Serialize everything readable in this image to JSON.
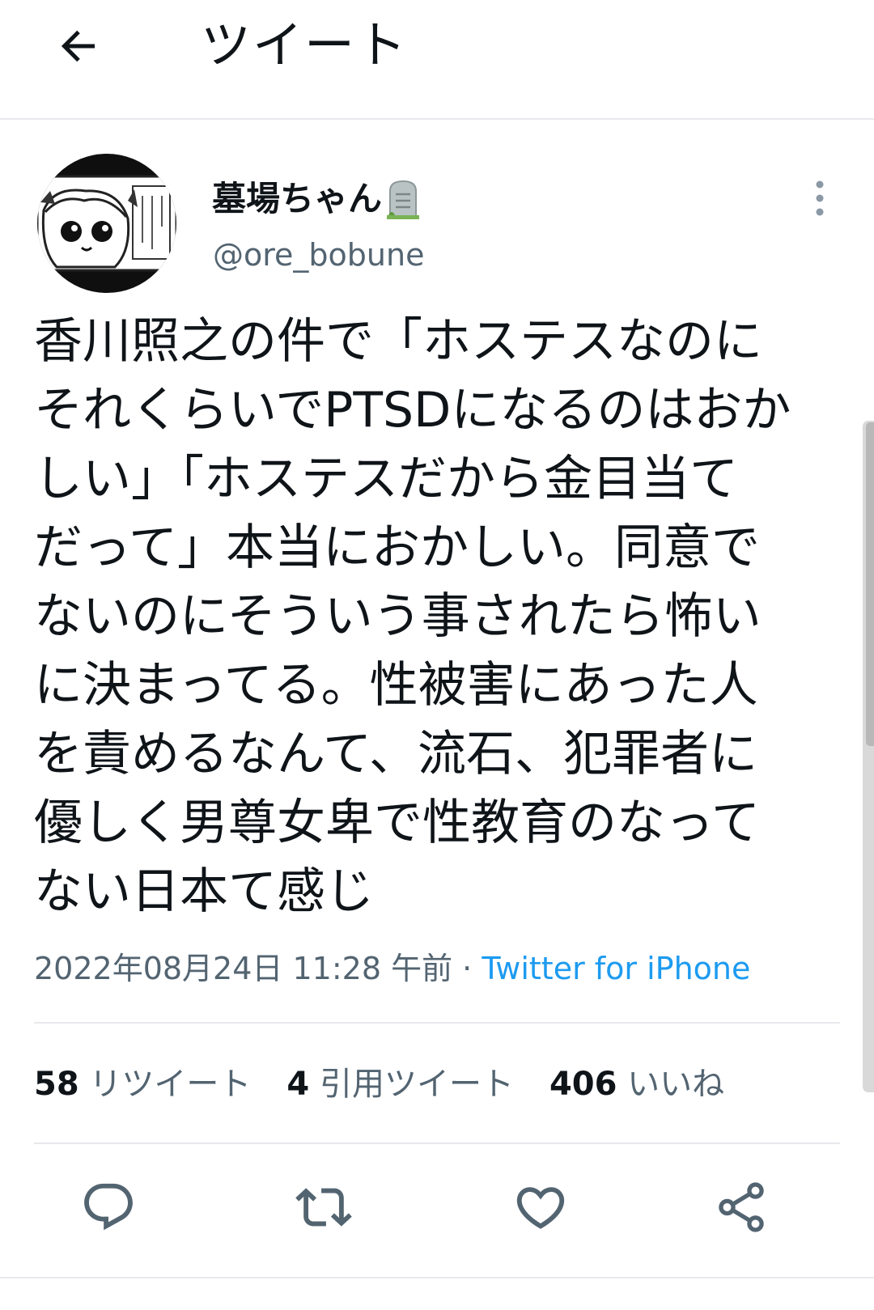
{
  "header": {
    "title": "ツイート",
    "back_icon": "arrow-left-icon"
  },
  "author": {
    "name": "墓場ちゃん",
    "handle": "@ore_bobune",
    "name_emoji": "headstone-icon"
  },
  "tweet": {
    "text": "香川照之の件で「ホステスなのに\nそれくらいでPTSDになるのはおか\nしい」「ホステスだから金目当て\nだって」本当におかしい。同意で\nないのにそういう事されたら怖い\nに決まってる。性被害にあった人\nを責めるなんて、流石、犯罪者に\n優しく男尊女卑で性教育のなって\nない日本て感じ",
    "timestamp": "2022年08月24日 11:28 午前",
    "separator": " · ",
    "client": "Twitter for iPhone"
  },
  "stats": {
    "retweets_count": "58",
    "retweets_label": "リツイート",
    "quotes_count": "4",
    "quotes_label": "引用ツイート",
    "likes_count": "406",
    "likes_label": "いいね"
  },
  "actions": [
    "reply-icon",
    "retweet-icon",
    "like-icon",
    "share-icon"
  ],
  "colors": {
    "link": "#1d9bf0",
    "secondary_text": "#536471",
    "primary_text": "#0f1419",
    "divider": "#e7e9ec"
  }
}
